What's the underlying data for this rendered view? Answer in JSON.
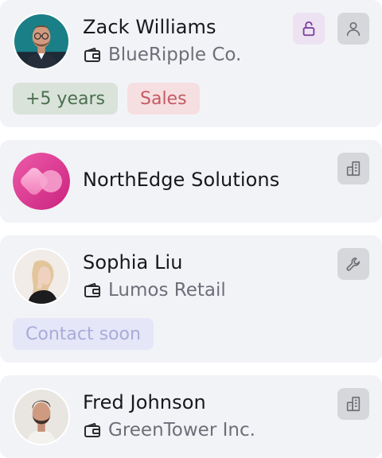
{
  "contacts": [
    {
      "name": "Zack Williams",
      "company": "BlueRipple Co.",
      "tags": [
        "+5 years",
        "Sales"
      ],
      "icons": [
        "lock-open-icon",
        "user-icon"
      ]
    },
    {
      "name": "NorthEdge Solutions",
      "icons": [
        "building-icon"
      ]
    },
    {
      "name": "Sophia Liu",
      "company": "Lumos Retail",
      "tags": [
        "Contact soon"
      ],
      "icons": [
        "wrench-icon"
      ]
    },
    {
      "name": "Fred Johnson",
      "company": "GreenTower Inc.",
      "icons": [
        "building-icon"
      ]
    }
  ],
  "colors": {
    "card_bg": "#f2f3f7",
    "tag_green_bg": "#d9e3da",
    "tag_red_bg": "#f6dfe1",
    "tag_lavender_bg": "#e5e6f8",
    "lock_button_bg": "#ece2f2",
    "icon_button_bg": "#d6d7db",
    "logo_magenta": "#e0409a"
  }
}
